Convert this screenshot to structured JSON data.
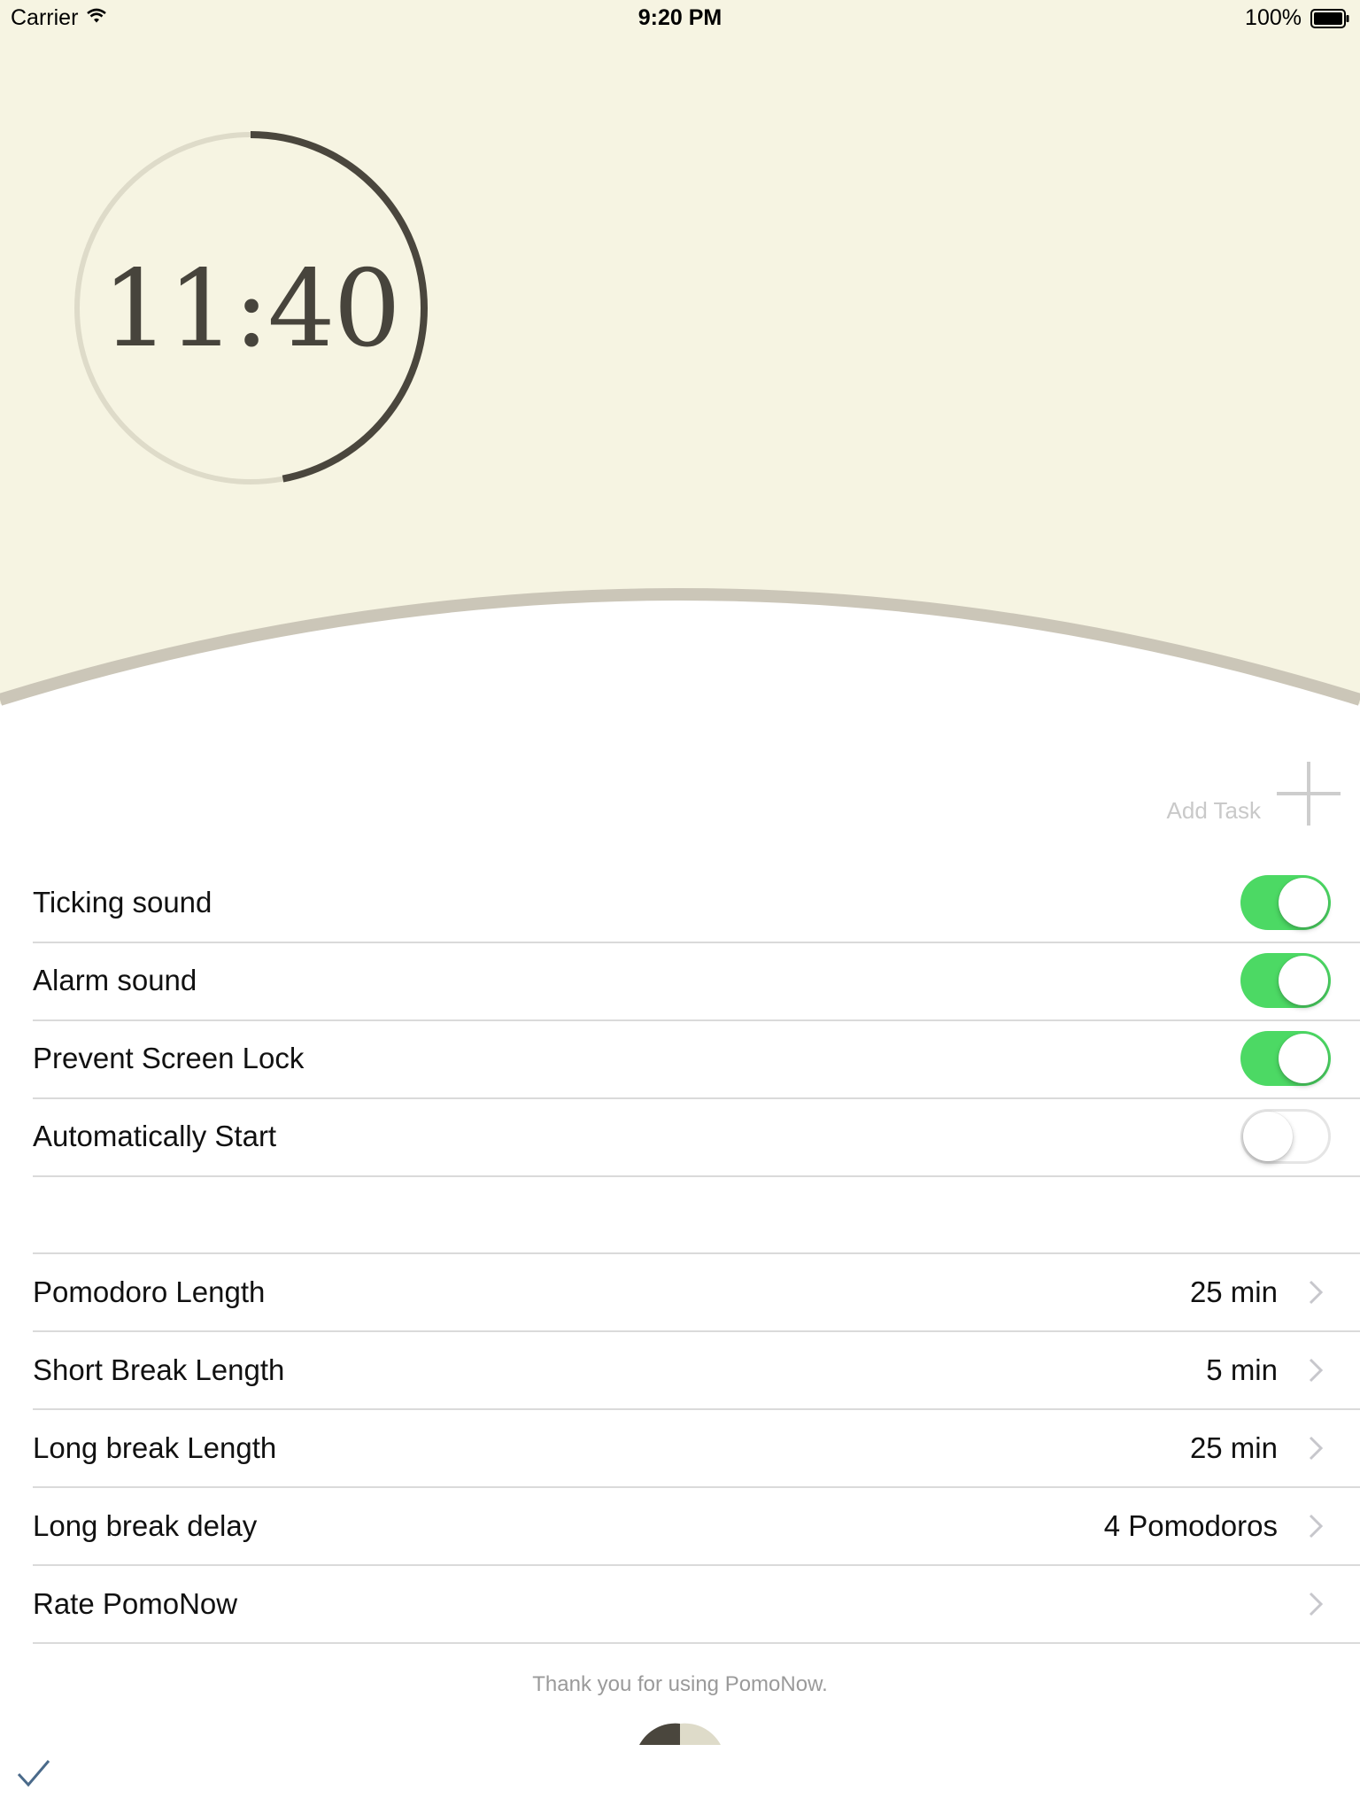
{
  "status_bar": {
    "carrier": "Carrier",
    "time": "9:20 PM",
    "battery": "100%"
  },
  "timer": {
    "display": "11:40",
    "progress": 0.47,
    "track_color": "#dedbc9",
    "progress_color": "#4a463d"
  },
  "colors": {
    "panel_bg": "#f6f4e2",
    "arc": "#cbc6b8",
    "toggle_on": "#4cd964"
  },
  "add_task": {
    "label": "Add Task"
  },
  "toggles": [
    {
      "label": "Ticking sound",
      "on": true
    },
    {
      "label": "Alarm sound",
      "on": true
    },
    {
      "label": "Prevent Screen Lock",
      "on": true
    },
    {
      "label": "Automatically Start",
      "on": false
    }
  ],
  "settings": [
    {
      "label": "Pomodoro Length",
      "value": "25 min"
    },
    {
      "label": "Short Break Length",
      "value": "5 min"
    },
    {
      "label": "Long break Length",
      "value": "25 min"
    },
    {
      "label": "Long break delay",
      "value": "4 Pomodoros"
    },
    {
      "label": "Rate PomoNow",
      "value": ""
    }
  ],
  "footer": {
    "text": "Thank you for using PomoNow."
  },
  "icons": {
    "wifi": "wifi-icon",
    "battery": "battery-icon",
    "add": "plus-icon",
    "chevron": "chevron-right-icon",
    "check": "checkmark-icon"
  }
}
